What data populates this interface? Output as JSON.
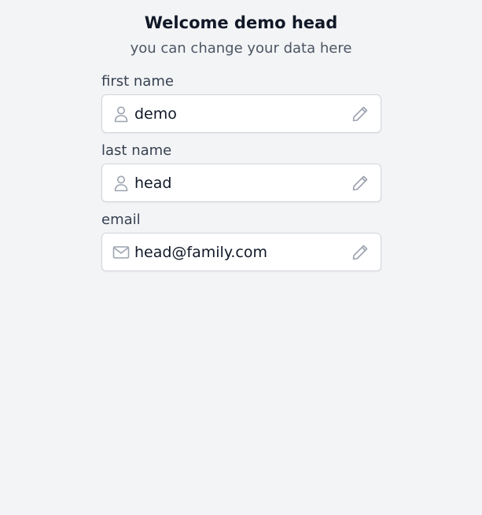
{
  "header": {
    "title": "Welcome demo head",
    "subtitle": "you can change your data here"
  },
  "fields": [
    {
      "label": "first name",
      "value": "demo",
      "icon": "user-icon"
    },
    {
      "label": "last name",
      "value": "head",
      "icon": "user-icon"
    },
    {
      "label": "email",
      "value": "head@family.com",
      "icon": "mail-icon"
    }
  ],
  "colors": {
    "background": "#f3f4f6",
    "icon": "#9ca3af",
    "text": "#111827"
  }
}
